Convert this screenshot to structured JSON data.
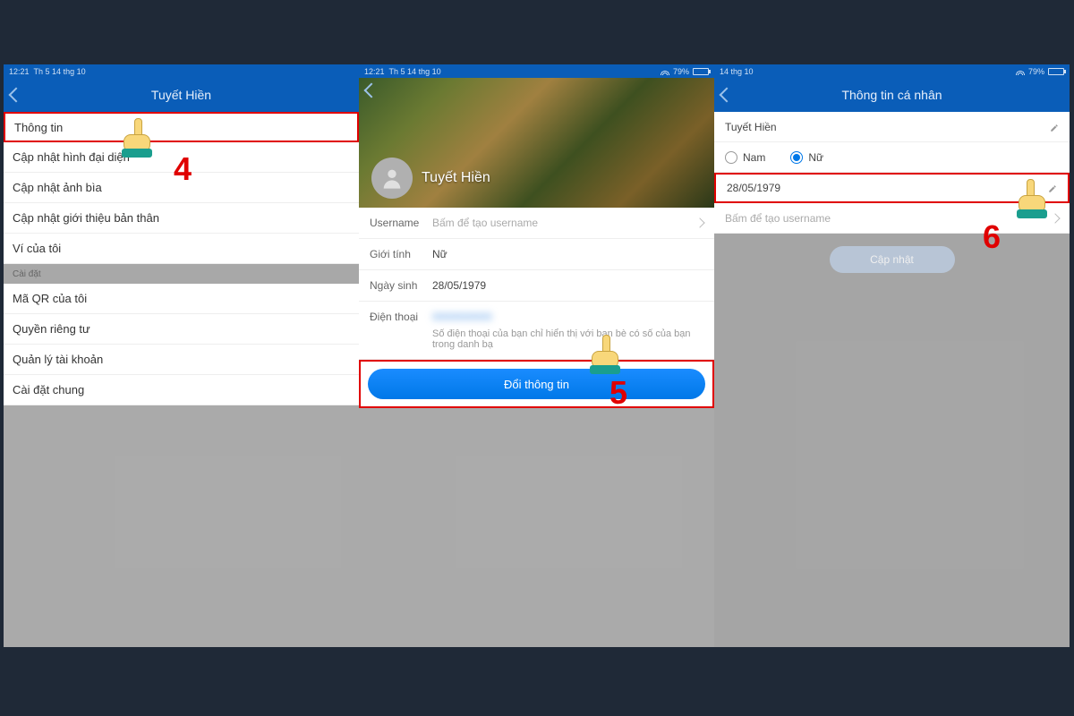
{
  "status": {
    "time": "12:21",
    "date": "Th 5 14 thg 10",
    "battery": "79%"
  },
  "panel1": {
    "title": "Tuyết Hiền",
    "menu": [
      "Thông tin",
      "Cập nhật hình đại diện",
      "Cập nhật ảnh bìa",
      "Cập nhật giới thiệu bản thân",
      "Ví của tôi"
    ],
    "section": "Cài đặt",
    "settings": [
      "Mã QR của tôi",
      "Quyền riêng tư",
      "Quản lý tài khoản",
      "Cài đặt chung"
    ],
    "callout": "4"
  },
  "panel2": {
    "display_name": "Tuyết Hiền",
    "rows": {
      "username_label": "Username",
      "username_placeholder": "Bấm để tạo username",
      "gender_label": "Giới tính",
      "gender_val": "Nữ",
      "dob_label": "Ngày sinh",
      "dob_val": "28/05/1979",
      "phone_label": "Điện thoại",
      "phone_note": "Số điện thoại của bạn chỉ hiển thị với bạn bè có số của bạn trong danh bạ"
    },
    "button": "Đổi thông tin",
    "callout": "5"
  },
  "panel3": {
    "title": "Thông tin cá nhân",
    "name": "Tuyết Hiền",
    "gender": {
      "male": "Nam",
      "female": "Nữ"
    },
    "dob": "28/05/1979",
    "username_placeholder": "Bấm để tạo username",
    "button": "Cập nhật",
    "callout": "6"
  }
}
